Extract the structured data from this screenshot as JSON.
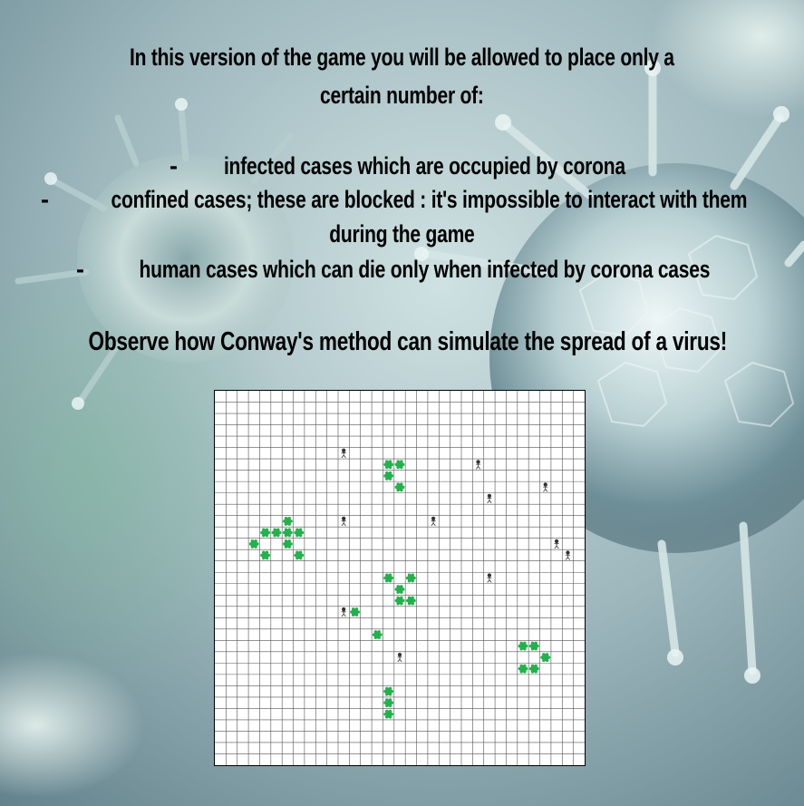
{
  "intro": {
    "line1": "In this version of the game you will be allowed to place only a",
    "line2": "certain number of:"
  },
  "rules": [
    {
      "bullet": "-",
      "text": "infected cases which are occupied by corona"
    },
    {
      "bullet": "-",
      "text": "confined cases; these are blocked : it's impossible to interact with them",
      "continuation": "during the game"
    },
    {
      "bullet": "-",
      "text": "human cases  which can die only when infected by corona cases"
    }
  ],
  "tagline": "Observe how Conway's method can simulate the spread of a virus!",
  "board": {
    "cols": 33,
    "rows": 33,
    "infected_color": "#22b24c",
    "human_color": "#333333",
    "infected_cells": [
      [
        5,
        12
      ],
      [
        6,
        12
      ],
      [
        6,
        13
      ],
      [
        7,
        14
      ],
      [
        6,
        11
      ],
      [
        5,
        12
      ],
      [
        15,
        6
      ],
      [
        16,
        6
      ],
      [
        15,
        7
      ],
      [
        16,
        8
      ],
      [
        6,
        12
      ],
      [
        7,
        12
      ],
      [
        5,
        12
      ],
      [
        4,
        12
      ],
      [
        3,
        13
      ],
      [
        4,
        14
      ],
      [
        15,
        16
      ],
      [
        17,
        16
      ],
      [
        16,
        17
      ],
      [
        17,
        18
      ],
      [
        16,
        18
      ],
      [
        12,
        19
      ],
      [
        14,
        21
      ],
      [
        15,
        26
      ],
      [
        15,
        27
      ],
      [
        15,
        28
      ],
      [
        27,
        22
      ],
      [
        28,
        22
      ],
      [
        29,
        23
      ],
      [
        28,
        24
      ],
      [
        27,
        24
      ]
    ],
    "human_cells": [
      [
        11,
        5
      ],
      [
        23,
        6
      ],
      [
        24,
        9
      ],
      [
        29,
        8
      ],
      [
        11,
        11
      ],
      [
        19,
        11
      ],
      [
        30,
        13
      ],
      [
        31,
        14
      ],
      [
        24,
        16
      ],
      [
        11,
        19
      ],
      [
        16,
        23
      ]
    ]
  },
  "colors": {
    "text": "#000000",
    "grid_line": "#555555",
    "board_bg": "#ffffff"
  }
}
